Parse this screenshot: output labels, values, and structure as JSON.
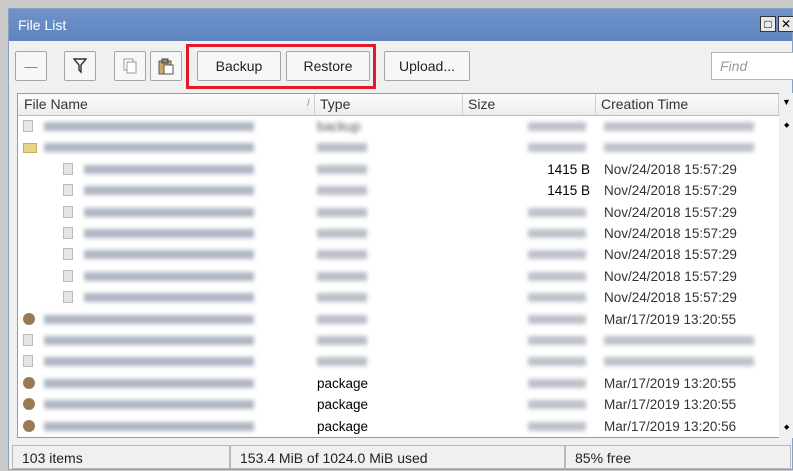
{
  "window": {
    "title": "File List",
    "maximize_glyph": "□",
    "close_glyph": "✕"
  },
  "toolbar": {
    "remove_glyph": "—",
    "filter_icon": "filter-icon",
    "copy_icon": "copy-icon",
    "paste_icon": "paste-icon",
    "backup_label": "Backup",
    "restore_label": "Restore",
    "upload_label": "Upload...",
    "find_placeholder": "Find"
  },
  "columns": {
    "name": "File Name",
    "type": "Type",
    "size": "Size",
    "ctime": "Creation Time",
    "sort_glyph": "/"
  },
  "rows": [
    {
      "icon": "file",
      "indent": 0,
      "name": "",
      "type": "backup",
      "size": "",
      "ctime": ""
    },
    {
      "icon": "folder",
      "indent": 0,
      "name": "",
      "type": "",
      "size": "",
      "ctime": ""
    },
    {
      "icon": "file",
      "indent": 1,
      "name": "",
      "type": "",
      "size": "1415 B",
      "ctime": "Nov/24/2018 15:57:29"
    },
    {
      "icon": "file",
      "indent": 1,
      "name": "",
      "type": "",
      "size": "1415 B",
      "ctime": "Nov/24/2018 15:57:29"
    },
    {
      "icon": "file",
      "indent": 1,
      "name": "",
      "type": "",
      "size": "",
      "ctime": "Nov/24/2018 15:57:29"
    },
    {
      "icon": "file",
      "indent": 1,
      "name": "",
      "type": "",
      "size": "",
      "ctime": "Nov/24/2018 15:57:29"
    },
    {
      "icon": "file",
      "indent": 1,
      "name": "",
      "type": "",
      "size": "",
      "ctime": "Nov/24/2018 15:57:29"
    },
    {
      "icon": "file",
      "indent": 1,
      "name": "",
      "type": "",
      "size": "",
      "ctime": "Nov/24/2018 15:57:29"
    },
    {
      "icon": "file",
      "indent": 1,
      "name": "",
      "type": "",
      "size": "",
      "ctime": "Nov/24/2018 15:57:29"
    },
    {
      "icon": "pkg",
      "indent": 0,
      "name": "",
      "type": "",
      "size": "",
      "ctime": "Mar/17/2019 13:20:55"
    },
    {
      "icon": "file",
      "indent": 0,
      "name": "",
      "type": "",
      "size": "",
      "ctime": ""
    },
    {
      "icon": "file",
      "indent": 0,
      "name": "",
      "type": "",
      "size": "",
      "ctime": ""
    },
    {
      "icon": "pkg",
      "indent": 0,
      "name": "",
      "type": "package",
      "size": "",
      "ctime": "Mar/17/2019 13:20:55"
    },
    {
      "icon": "pkg",
      "indent": 0,
      "name": "",
      "type": "package",
      "size": "",
      "ctime": "Mar/17/2019 13:20:55"
    },
    {
      "icon": "pkg",
      "indent": 0,
      "name": "",
      "type": "package",
      "size": "",
      "ctime": "Mar/17/2019 13:20:56"
    }
  ],
  "status": {
    "items": "103 items",
    "used": "153.4 MiB of 1024.0 MiB used",
    "free": "85% free"
  }
}
